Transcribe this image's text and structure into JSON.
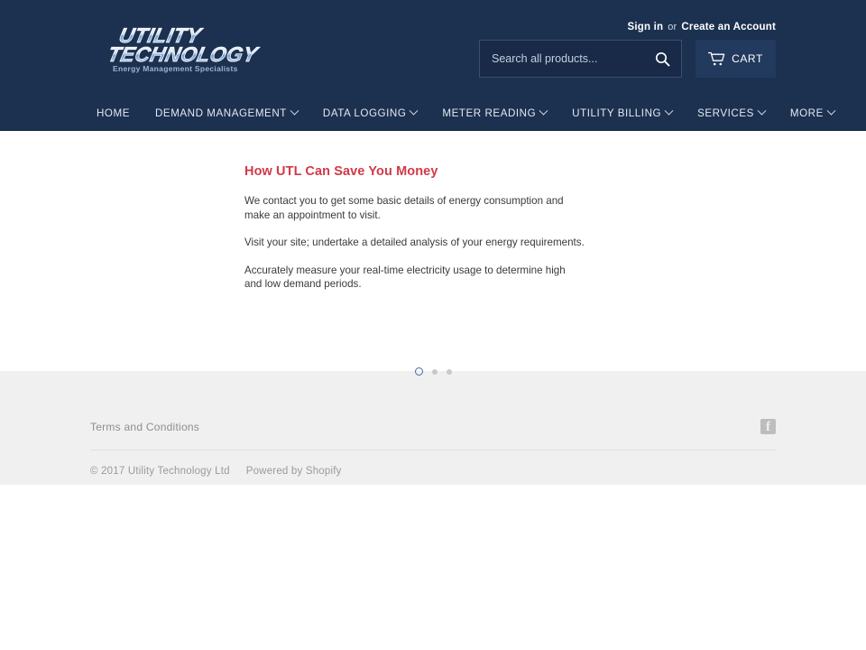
{
  "header": {
    "logo": {
      "line1": "UTILITY",
      "line2": "TECHNOLOGY",
      "tagline": "Energy Management Specialists"
    },
    "account": {
      "sign_in": "Sign in",
      "or": "or",
      "create_account": "Create an Account"
    },
    "search": {
      "placeholder": "Search all products...",
      "value": "",
      "icon": "search-icon"
    },
    "cart": {
      "label": "CART",
      "icon": "shopping-cart-icon"
    }
  },
  "nav": {
    "items": [
      {
        "label": "HOME",
        "has_dropdown": false
      },
      {
        "label": "DEMAND MANAGEMENT",
        "has_dropdown": true
      },
      {
        "label": "DATA LOGGING",
        "has_dropdown": true
      },
      {
        "label": "METER READING",
        "has_dropdown": true
      },
      {
        "label": "UTILITY BILLING",
        "has_dropdown": true
      },
      {
        "label": "SERVICES",
        "has_dropdown": true
      },
      {
        "label": "MORE",
        "has_dropdown": true
      }
    ]
  },
  "slide": {
    "title": "How UTL Can Save You Money",
    "paragraphs": [
      "We contact you to get some basic details of energy consumption and make an appointment to visit.",
      "Visit your site; undertake a detailed analysis of your energy requirements.",
      "Accurately measure your real-time electricity usage to determine high and low demand periods."
    ],
    "dots": [
      {
        "active": true
      },
      {
        "active": false
      },
      {
        "active": false
      }
    ]
  },
  "footer": {
    "terms_label": "Terms and Conditions",
    "social": [
      {
        "name": "facebook-icon",
        "glyph": "f"
      }
    ],
    "copyright": "© 2017 Utility Technology Ltd",
    "powered_by": "Powered by Shopify"
  },
  "colors": {
    "header_navy": "#1c3050",
    "accent_red": "#d03a48",
    "footer_gray": "#f0f0f0",
    "dot_active": "#3f6fa8"
  }
}
